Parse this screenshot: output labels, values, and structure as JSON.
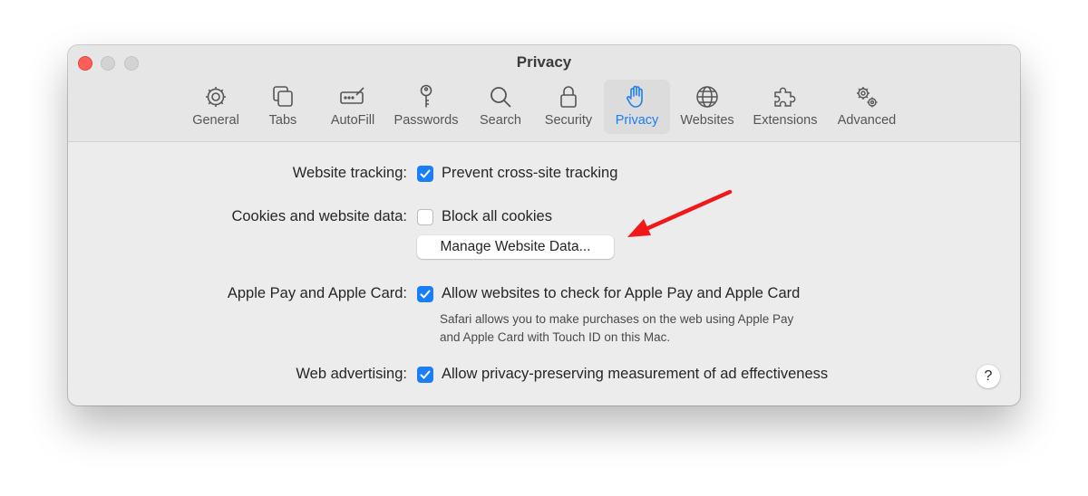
{
  "window": {
    "title": "Privacy"
  },
  "tabs": [
    {
      "label": "General",
      "icon": "gear-icon"
    },
    {
      "label": "Tabs",
      "icon": "tabs-icon"
    },
    {
      "label": "AutoFill",
      "icon": "autofill-icon"
    },
    {
      "label": "Passwords",
      "icon": "key-icon"
    },
    {
      "label": "Search",
      "icon": "search-icon"
    },
    {
      "label": "Security",
      "icon": "lock-icon"
    },
    {
      "label": "Privacy",
      "icon": "hand-icon",
      "selected": true
    },
    {
      "label": "Websites",
      "icon": "globe-icon"
    },
    {
      "label": "Extensions",
      "icon": "puzzle-icon"
    },
    {
      "label": "Advanced",
      "icon": "gears-icon"
    }
  ],
  "settings": {
    "tracking": {
      "label": "Website tracking:",
      "option": "Prevent cross-site tracking",
      "checked": true
    },
    "cookies": {
      "label": "Cookies and website data:",
      "option": "Block all cookies",
      "checked": false,
      "button": "Manage Website Data..."
    },
    "applepay": {
      "label": "Apple Pay and Apple Card:",
      "option": "Allow websites to check for Apple Pay and Apple Card",
      "checked": true,
      "description_line1": "Safari allows you to make purchases on the web using Apple Pay",
      "description_line2": "and Apple Card with Touch ID on this Mac."
    },
    "advertising": {
      "label": "Web advertising:",
      "option": "Allow privacy-preserving measurement of ad effectiveness",
      "checked": true
    }
  },
  "help": {
    "label": "?"
  },
  "colors": {
    "accent": "#1a7ef5",
    "annotation_arrow": "#f21818",
    "close_button": "#ff5f57"
  }
}
